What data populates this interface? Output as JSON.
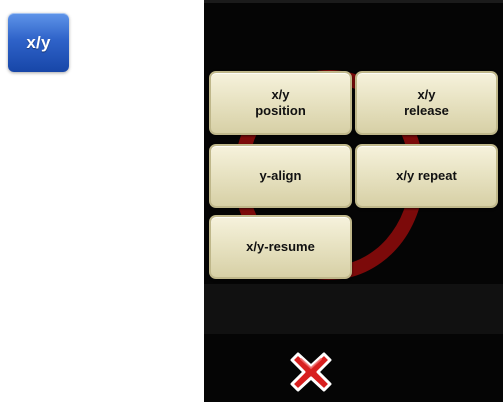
{
  "launcher": {
    "label": "x/y"
  },
  "menu": {
    "items": [
      {
        "label": "x/y\nposition"
      },
      {
        "label": "x/y\nrelease"
      },
      {
        "label": "y-align"
      },
      {
        "label": "x/y repeat"
      },
      {
        "label": "x/y-resume"
      }
    ]
  },
  "close": {
    "icon": "close-icon"
  },
  "colors": {
    "launcher_blue": "#2f63c9",
    "button_cream": "#e8e3c3",
    "panel_black": "#050505",
    "close_red": "#d81f1f"
  }
}
